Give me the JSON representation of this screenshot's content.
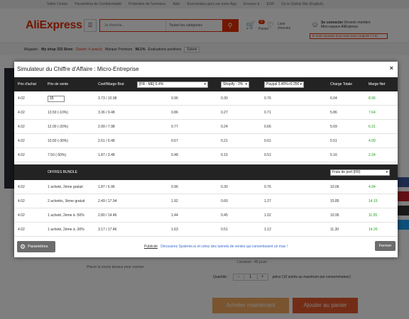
{
  "topbar": {
    "items": [
      "Seller Center",
      "Paramètres de Confidentialité",
      "Protection de l'acheteur",
      "Aide",
      "Économisez gros sur notre App",
      "Envoyer à",
      "EUR",
      "Go to Global Site (English)"
    ]
  },
  "header": {
    "logo": "AliExpress",
    "search_placeholder": "Je cherche...",
    "category": "Toutes les catégories",
    "cart_count": "0",
    "cart_label": "Panier",
    "wishlist_label": "Liste d'envies",
    "signin": "Se connecter",
    "register": "Devenir membre",
    "account": "Mon espace AliExpress",
    "new_user": "Je suis nouveau ici je veux mes coupons ! 3 $ ›"
  },
  "store": {
    "label": "Magasin:",
    "name": "My shop 333 Store",
    "opened": "Ouvert: 4 year(s)",
    "premium": "Marque Premium",
    "rating": "98.1%",
    "rating_label": "Évaluations positives",
    "follow": "Suivre"
  },
  "page": {
    "zoom_hint": "Placer la souris dessus pour zoomer",
    "livraison": "Livraison : 45 jours",
    "quantity_label": "Quantité :",
    "quantity": "1",
    "quantity_note": "pièce (10 unités au maximum par consommateur)",
    "buy_now": "Acheter maintenant",
    "add_to_cart": "Ajouter au panier"
  },
  "modal": {
    "title": "Simulateur du Chiffre d'Affaire : Micro-Entreprise",
    "close_icon": "×",
    "headers": {
      "prix_achat": "Prix d'achat",
      "prix_vente": "Prix de vente",
      "coef": "Coef/Marge Brut",
      "tax_select": "[FR - ME] 6.4%",
      "shopify_select": "Shopify - 2%",
      "paypal_select": "Paypal 3.40%+0.25€",
      "charge": "Charge Totale",
      "marge": "Marge Net"
    },
    "rows": [
      {
        "achat": "4.02",
        "vente": "15",
        "coef": "3.73 / 10.98",
        "tax": "0.96",
        "shopify": "0.30",
        "paypal": "0.76",
        "charge": "6.04",
        "marge": "8.96"
      },
      {
        "achat": "4.02",
        "vente": "13.50 (-10%)",
        "coef": "3.36 / 9.48",
        "tax": "0.86",
        "shopify": "0.27",
        "paypal": "0.71",
        "charge": "5.86",
        "marge": "7.64"
      },
      {
        "achat": "4.02",
        "vente": "12.00 (-20%)",
        "coef": "2.99 / 7.98",
        "tax": "0.77",
        "shopify": "0.24",
        "paypal": "0.66",
        "charge": "5.69",
        "marge": "6.31"
      },
      {
        "achat": "4.02",
        "vente": "10.50 (-30%)",
        "coef": "2.61 / 6.48",
        "tax": "0.67",
        "shopify": "0.21",
        "paypal": "0.61",
        "charge": "5.51",
        "marge": "4.99"
      },
      {
        "achat": "4.02",
        "vente": "7.50 (-50%)",
        "coef": "1.87 / 3.48",
        "tax": "0.48",
        "shopify": "0.15",
        "paypal": "0.51",
        "charge": "5.16",
        "marge": "2.34"
      }
    ],
    "bundle": {
      "header": "OFFRES BUNDLE",
      "shipping_select": "Frais de port (FR)",
      "rows": [
        {
          "achat": "4.02",
          "offre": "1 acheté, 2ème gratuit",
          "coef": "1.87 / 6.96",
          "tax": "0.96",
          "shopify": "0.30",
          "paypal": "0.76",
          "charge": "10.06",
          "marge": "4.94"
        },
        {
          "achat": "4.02",
          "offre": "2 achetés, 3ème gratuit",
          "coef": "2.49 / 17.94",
          "tax": "1.92",
          "shopify": "0.60",
          "paypal": "1.27",
          "charge": "15.85",
          "marge": "14.15"
        },
        {
          "achat": "4.02",
          "offre": "1 acheté, 2ème à -50%",
          "coef": "2.80 / 14.46",
          "tax": "1.44",
          "shopify": "0.45",
          "paypal": "1.02",
          "charge": "10.95",
          "marge": "11.55"
        },
        {
          "achat": "4.02",
          "offre": "1 acheté, 2ème à -30%",
          "coef": "3.17 / 17.46",
          "tax": "1.63",
          "shopify": "0.51",
          "paypal": "1.12",
          "charge": "11.30",
          "marge": "14.20"
        }
      ]
    },
    "footer": {
      "params": "Paramètres",
      "pub": "Publicité",
      "promo": "Découvrez Systeme.io et créez des tunnels de ventes qui convertissent un max !",
      "close": "Fermer"
    }
  }
}
